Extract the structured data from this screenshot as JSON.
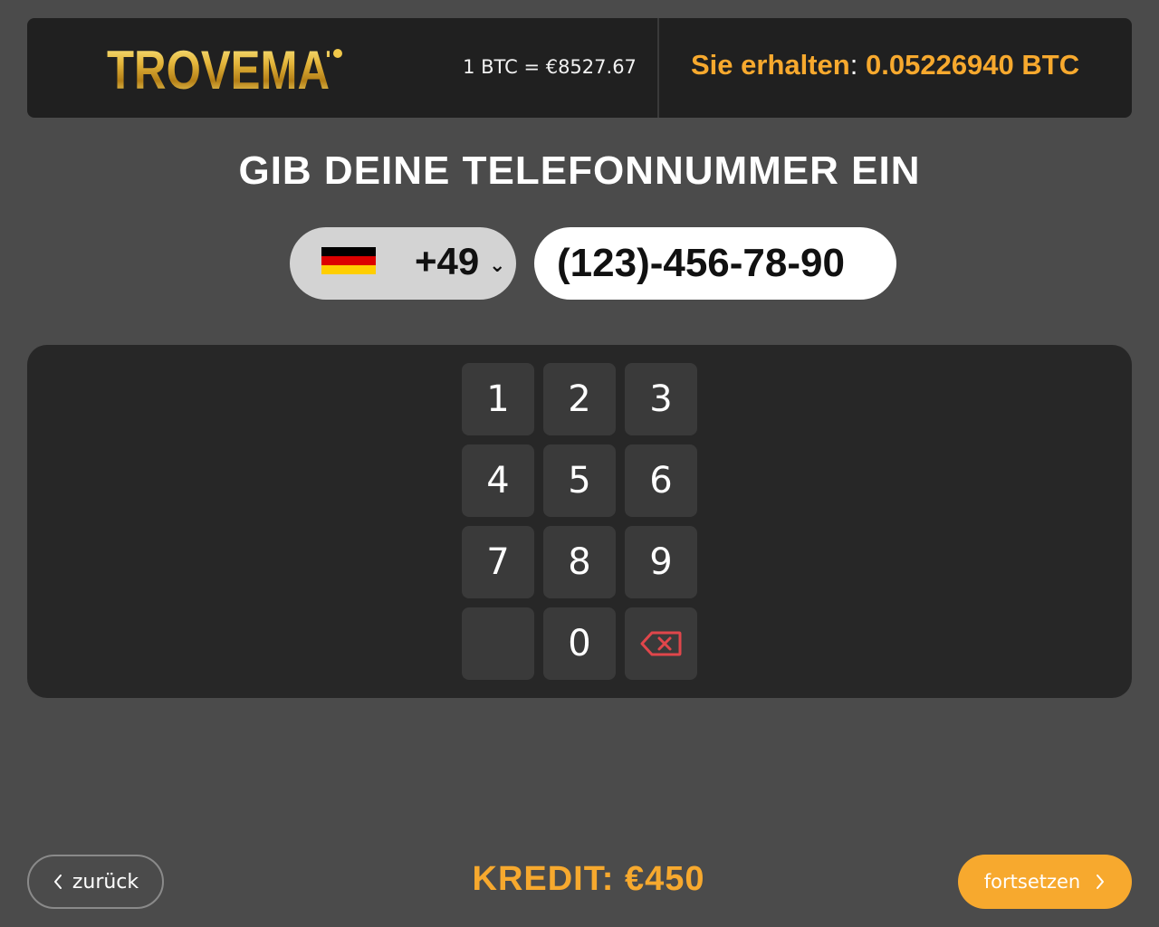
{
  "header": {
    "logo": "TROVEMAT",
    "rate": "1 BTC = €8527.67",
    "receive_label": "Sie erhalten",
    "receive_colon": ":",
    "receive_value": "0.05226940 BTC"
  },
  "title": "GIB DEINE TELEFONNUMMER EIN",
  "phone": {
    "country_flag": "germany-flag-icon",
    "country_code": "+49",
    "number": "(123)-456-78-90"
  },
  "keypad": {
    "keys": [
      "1",
      "2",
      "3",
      "4",
      "5",
      "6",
      "7",
      "8",
      "9",
      "",
      "0"
    ],
    "backspace_icon": "backspace-icon"
  },
  "footer": {
    "back_label": "zurück",
    "credit": "KREDIT: €450",
    "continue_label": "fortsetzen"
  },
  "colors": {
    "background": "#4b4b4b",
    "header": "#202020",
    "panel": "#272727",
    "key": "#3a3a3a",
    "accent": "#f7a92e",
    "backspace": "#e0464b"
  }
}
